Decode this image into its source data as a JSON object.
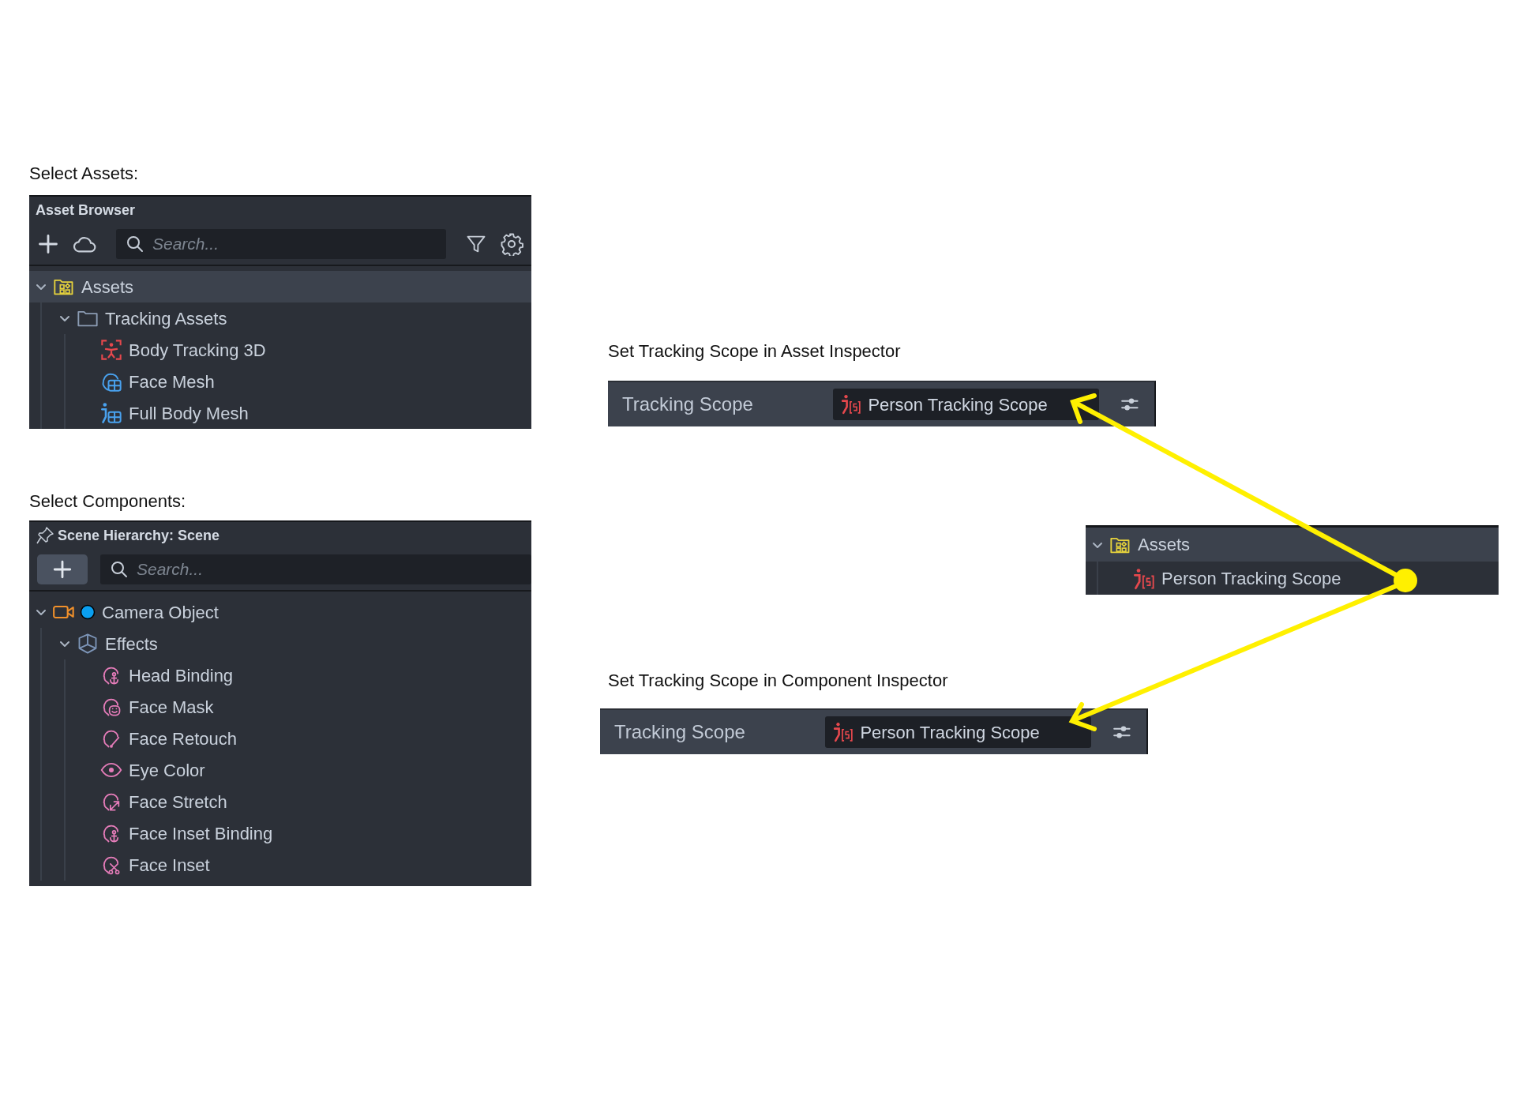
{
  "asset_browser": {
    "caption": "Select Assets:",
    "title": "Asset Browser",
    "search": {
      "placeholder": "Search..."
    },
    "tree": [
      {
        "label": "Assets",
        "kind": "assets-folder",
        "selected": true,
        "expanded": true,
        "children": [
          {
            "label": "Tracking Assets",
            "kind": "folder",
            "selected": false,
            "expanded": true,
            "children": [
              {
                "label": "Body Tracking 3D",
                "kind": "body-tracking",
                "selected": false
              },
              {
                "label": "Face Mesh",
                "kind": "face-mesh",
                "selected": false
              },
              {
                "label": "Full Body Mesh",
                "kind": "full-body-mesh",
                "selected": false
              }
            ]
          }
        ]
      }
    ]
  },
  "scene_hierarchy": {
    "caption": "Select Components:",
    "title": "Scene Hierarchy: Scene",
    "search": {
      "placeholder": "Search..."
    },
    "tree": [
      {
        "label": "Camera Object",
        "kind": "camera",
        "color": "#0a9ff0",
        "selected": false,
        "expanded": true,
        "children": [
          {
            "label": "Effects",
            "kind": "effects",
            "selected": false,
            "expanded": true,
            "children": [
              {
                "label": "Head Binding",
                "kind": "face-anchor",
                "selected": false
              },
              {
                "label": "Face Mask",
                "kind": "face-mask",
                "selected": false
              },
              {
                "label": "Face Retouch",
                "kind": "face-retouch",
                "selected": false
              },
              {
                "label": "Eye Color",
                "kind": "eye",
                "selected": false
              },
              {
                "label": "Face Stretch",
                "kind": "face-stretch",
                "selected": false
              },
              {
                "label": "Face Inset Binding",
                "kind": "face-anchor",
                "selected": false
              },
              {
                "label": "Face Inset",
                "kind": "face-inset",
                "selected": false
              }
            ]
          }
        ]
      }
    ]
  },
  "asset_inspector": {
    "caption": "Set Tracking Scope in Asset Inspector",
    "label": "Tracking Scope",
    "value": "Person Tracking Scope"
  },
  "assets_panel": {
    "tree": [
      {
        "label": "Assets",
        "kind": "assets-folder",
        "selected": true,
        "expanded": true,
        "children": [
          {
            "label": "Person Tracking Scope",
            "kind": "person-scope",
            "selected": false
          }
        ]
      }
    ]
  },
  "component_inspector": {
    "caption": "Set Tracking Scope in Component Inspector",
    "label": "Tracking Scope",
    "value": "Person Tracking Scope"
  }
}
